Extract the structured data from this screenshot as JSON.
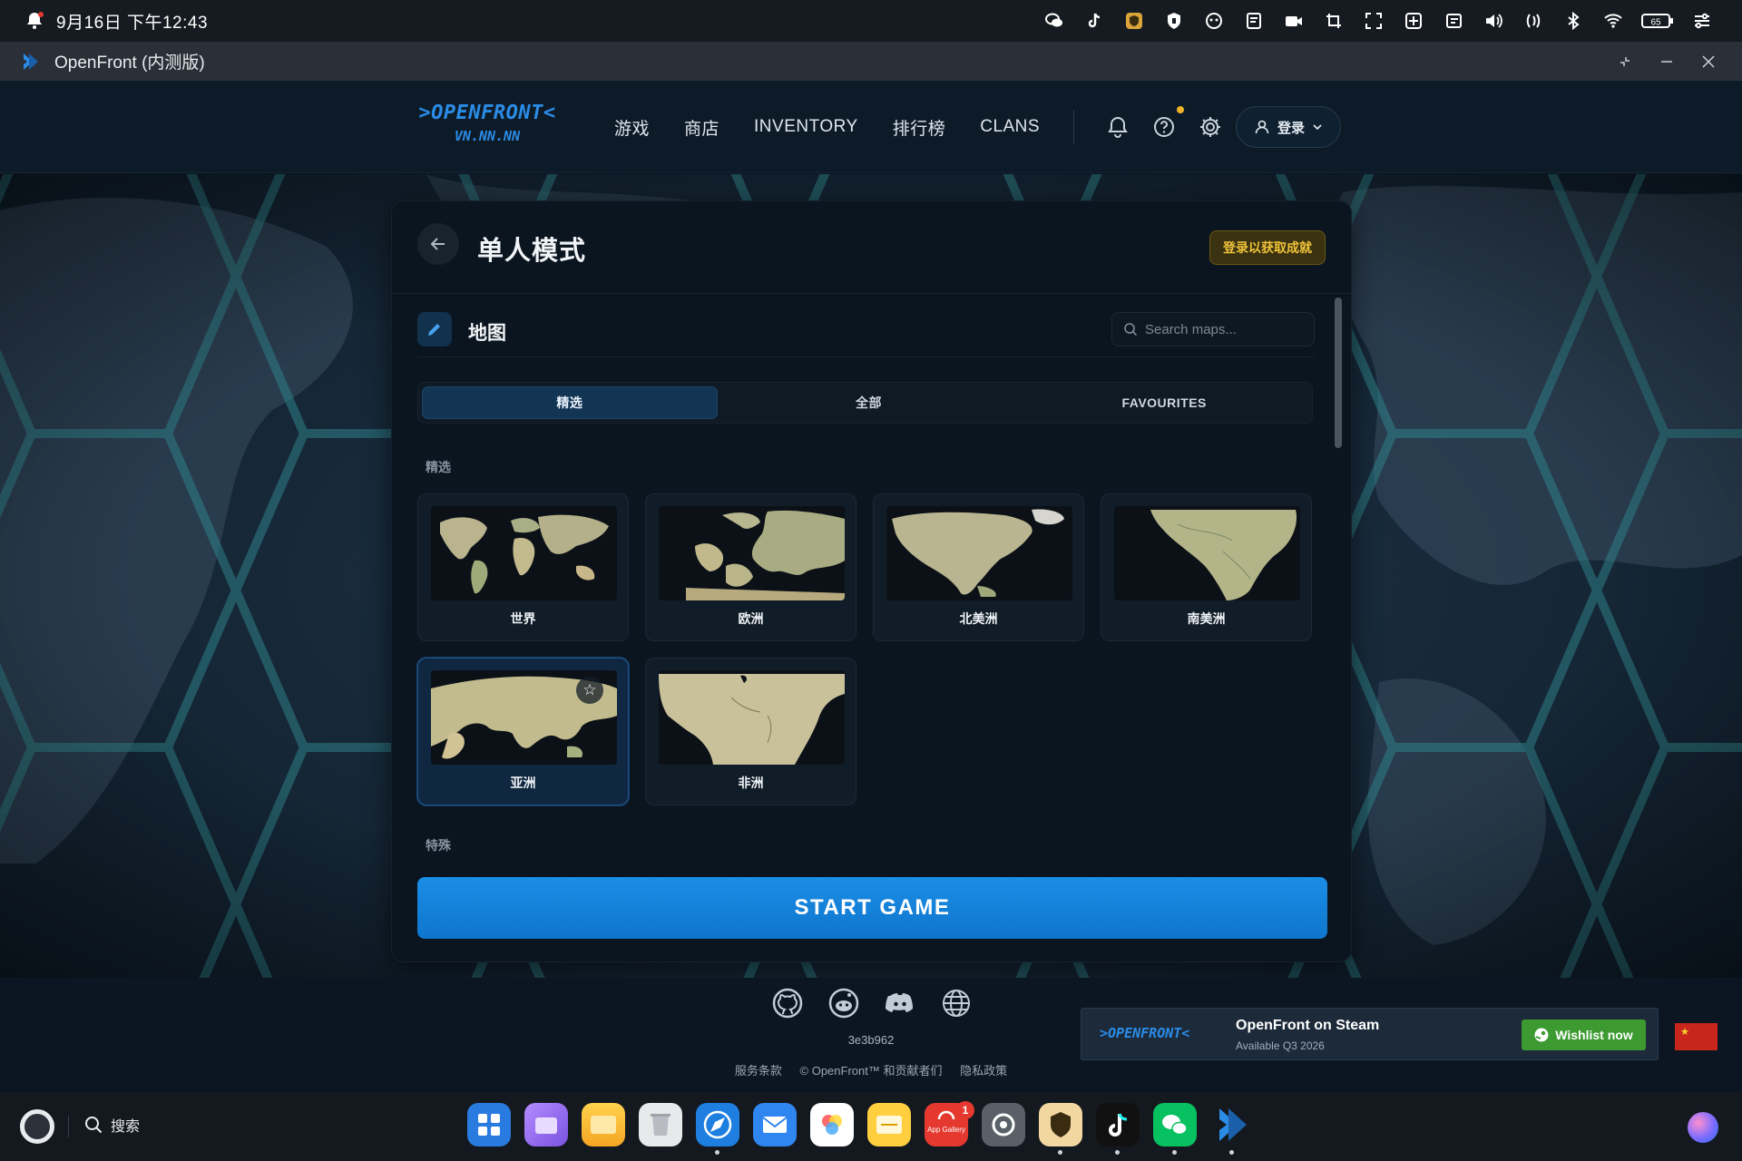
{
  "status_bar": {
    "datetime": "9月16日 下午12:43",
    "battery": "65",
    "tray_icons": [
      "wechat-icon",
      "tiktok-icon",
      "app-shield-icon",
      "vpn-shield-icon",
      "assistant-icon",
      "notes-icon",
      "screen-record-icon",
      "screenshot-icon",
      "fullscreen-icon",
      "calculator-icon",
      "clipboard-icon",
      "volume-icon",
      "nfc-icon",
      "bluetooth-icon",
      "wifi-icon",
      "battery-icon",
      "settings-toggle-icon"
    ]
  },
  "window": {
    "title": "OpenFront (内测版)"
  },
  "header": {
    "logo_line1": ">OPENFRONT<",
    "logo_line2": "VN.NN.NN",
    "nav": [
      "游戏",
      "商店",
      "INVENTORY",
      "排行榜",
      "CLANS"
    ],
    "login_label": "登录"
  },
  "panel": {
    "title": "单人模式",
    "achievements_button": "登录以获取成就",
    "map_section_label": "地图",
    "search_placeholder": "Search maps...",
    "tabs": [
      "精选",
      "全部",
      "FAVOURITES"
    ],
    "featured_label": "精选",
    "special_label": "特殊",
    "maps": [
      {
        "name": "世界"
      },
      {
        "name": "欧洲"
      },
      {
        "name": "北美洲"
      },
      {
        "name": "南美洲"
      },
      {
        "name": "亚洲",
        "selected": true
      },
      {
        "name": "非洲"
      }
    ],
    "start_button": "START GAME"
  },
  "footer": {
    "social_icons": [
      "github-icon",
      "reddit-icon",
      "discord-icon",
      "globe-icon"
    ],
    "version": "3e3b962",
    "links": [
      "服务条款",
      "© OpenFront™ 和贡献者们",
      "隐私政策"
    ],
    "steam": {
      "logo": ">OPENFRONT<",
      "title": "OpenFront on Steam",
      "subtitle": "Available Q3 2026",
      "button": "Wishlist now"
    }
  },
  "taskbar": {
    "search_label": "搜索",
    "badge_count": "1",
    "app_gallery_label": "App Gallery",
    "apps": [
      "launcher",
      "files-purple",
      "folder",
      "trash",
      "browser",
      "mail",
      "gallery",
      "notes",
      "app-gallery",
      "settings",
      "vpn",
      "tiktok",
      "wechat",
      "openfront"
    ]
  },
  "colors": {
    "accent": "#1b8ee6",
    "panel": "#0b1520",
    "gold": "#f0c33a",
    "wishlist": "#3c9a31"
  }
}
